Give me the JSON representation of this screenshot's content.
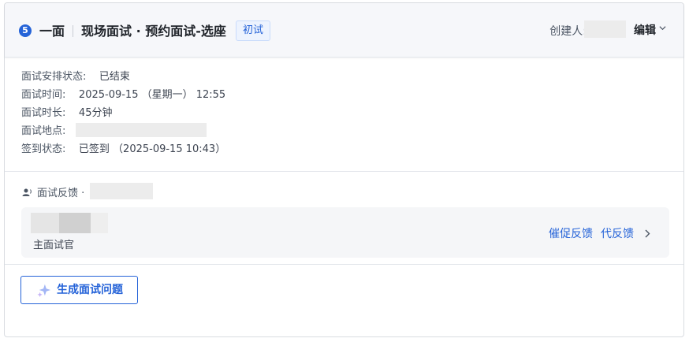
{
  "header": {
    "step_number": "5",
    "round": "一面",
    "title": "现场面试 · 预约面试-选座",
    "badge": "初试",
    "creator_label": "创建人:",
    "edit_label": "编辑"
  },
  "info": [
    {
      "label": "面试安排状态:",
      "value": "已结束"
    },
    {
      "label": "面试时间:",
      "value": "2025-09-15 （星期一） 12:55"
    },
    {
      "label": "面试时长:",
      "value": "45分钟"
    },
    {
      "label": "面试地点:",
      "value": ""
    },
    {
      "label": "签到状态:",
      "value": "已签到 （2025-09-15 10:43）"
    }
  ],
  "feedback": {
    "title": "面试反馈 ·",
    "interviewer_role": "主面试官",
    "urge_label": "催促反馈",
    "proxy_label": "代反馈"
  },
  "generate_button": "生成面试问题",
  "colors": {
    "accent": "#2563d8"
  }
}
